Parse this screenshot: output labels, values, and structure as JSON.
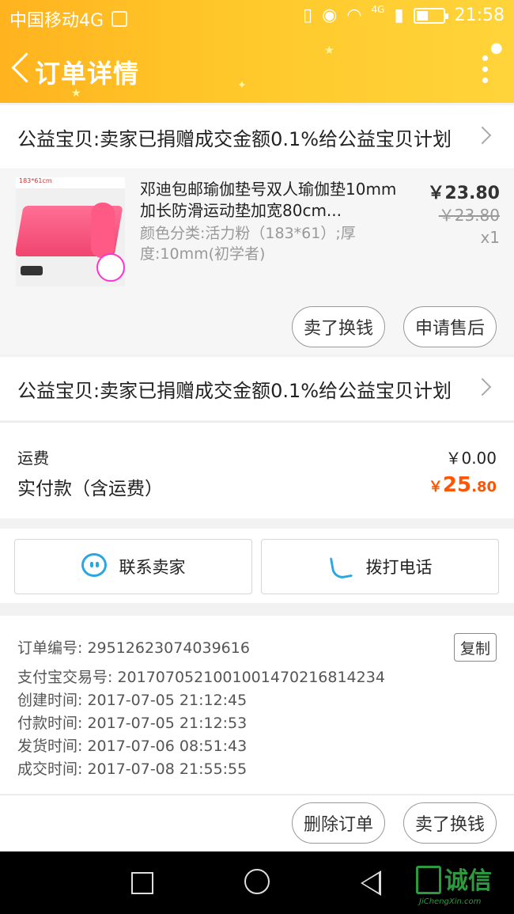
{
  "status_bar": {
    "carrier": "中国移动4G",
    "network_badge": "4G",
    "time": "21:58",
    "icons": [
      "vibrate-icon",
      "eye-icon",
      "wifi-icon",
      "signal-icon",
      "battery-icon"
    ]
  },
  "header": {
    "title": "订单详情",
    "accent_color": "#ffc82a"
  },
  "promo_1": "公益宝贝:卖家已捐赠成交金额0.1%给公益宝贝计划",
  "product": {
    "title": "邓迪包邮瑜伽垫号双人瑜伽垫10mm加长防滑运动垫加宽80cm...",
    "sku": "颜色分类:活力粉（183*61）;厚度:10mm(初学者)",
    "price": "￥23.80",
    "original_price": "￥23.80",
    "quantity": "x1",
    "thumb_tag": "183*61cm",
    "btn_sell": "卖了换钱",
    "btn_aftersale": "申请售后"
  },
  "promo_2": "公益宝贝:卖家已捐赠成交金额0.1%给公益宝贝计划",
  "fees": {
    "shipping_label": "运费",
    "shipping_value": "￥0.00",
    "paid_label": "实付款（含运费）",
    "paid_currency": "￥",
    "paid_int": "25",
    "paid_dec": ".80",
    "paid_color": "#ff5500"
  },
  "contact": {
    "seller": "联系卖家",
    "call": "拨打电话"
  },
  "order_info": {
    "order_no": "订单编号: 29512623074039616",
    "copy": "复制",
    "alipay_no": "支付宝交易号: 2017070521001001470216814234",
    "created": "创建时间: 2017-07-05 21:12:45",
    "paid": "付款时间: 2017-07-05 21:12:53",
    "shipped": "发货时间: 2017-07-06 08:51:43",
    "closed": "成交时间: 2017-07-08 21:55:55"
  },
  "footer_actions": {
    "delete": "删除订单",
    "sell": "卖了换钱"
  },
  "watermark": {
    "text": "诚信",
    "url": "JiChengXin.com"
  }
}
